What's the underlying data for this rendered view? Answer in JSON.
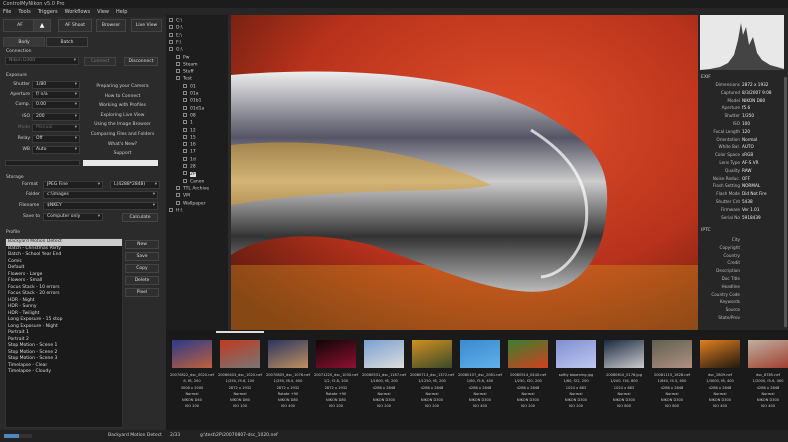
{
  "window": {
    "title": "ControlMyNikon v5.0 Pro"
  },
  "menu": [
    "File",
    "Tools",
    "Triggers",
    "Workflows",
    "View",
    "Help"
  ],
  "toolbar": {
    "af": "AF",
    "af_shoot": "AF Shoot",
    "browser": "Browser",
    "live_view": "Live View"
  },
  "tabs": {
    "body": "Body",
    "batch": "Batch"
  },
  "connection": {
    "label": "Connection",
    "camera": "Nikon D300",
    "connect": "Connect",
    "disconnect": "Disconnect"
  },
  "exposure": {
    "label": "Exposure",
    "rows": [
      {
        "label": "Shutter",
        "value": "1/80"
      },
      {
        "label": "Aperture",
        "value": "f/ n/a"
      },
      {
        "label": "Comp.",
        "value": "0.00"
      },
      {
        "label": "ISO",
        "value": "200"
      },
      {
        "label": "Mode",
        "value": "Manual"
      },
      {
        "label": "Relay",
        "value": "Off"
      },
      {
        "label": "WB",
        "value": "Auto"
      }
    ]
  },
  "help_links": [
    "Preparing your Camera",
    "How to Connect",
    "Working with Profiles",
    "Exploring Live View",
    "Using the Image Browser",
    "Comparing Files and Folders",
    "What's New?",
    "Support"
  ],
  "storage": {
    "label": "Storage",
    "format_label": "Format",
    "format": "JPEG Fine",
    "size": "L(4288*2848)",
    "folder_label": "Folder",
    "folder": "c:\\images",
    "filename_label": "Filename",
    "filename": "$NKEY",
    "saveto_label": "Save to",
    "saveto": "Computer only",
    "calculate": "Calculate"
  },
  "profile": {
    "label": "Profile",
    "items": [
      "Backyard Motion Detect",
      "Batch - Christmas Party",
      "Batch - School Year End",
      "Comic",
      "Default",
      "Flowers - Large",
      "Flowers - Small",
      "Focus Stack - 10 errors",
      "Focus Stack - 20 errors",
      "HDR - Night",
      "HDR - Sunny",
      "HDR - Twilight",
      "Long Exposure - 15 stop",
      "Long Exposure - Night",
      "Portrait 1",
      "Portrait 2",
      "Stop Motion - Scene 1",
      "Stop Motion - Scene 2",
      "Stop Motion - Scene 3",
      "Timelapse - Clear",
      "Timelapse - Cloudy"
    ],
    "buttons": [
      "New",
      "Save",
      "Copy",
      "Delete",
      "Pixel"
    ]
  },
  "tree": [
    {
      "d": 0,
      "t": "C:\\"
    },
    {
      "d": 0,
      "t": "D:\\"
    },
    {
      "d": 0,
      "t": "E:\\"
    },
    {
      "d": 0,
      "t": "F:\\"
    },
    {
      "d": 0,
      "t": "G:\\"
    },
    {
      "d": 1,
      "t": "Pw"
    },
    {
      "d": 1,
      "t": "Steam"
    },
    {
      "d": 1,
      "t": "Stuff"
    },
    {
      "d": 1,
      "t": "Test"
    },
    {
      "d": 2,
      "t": "01"
    },
    {
      "d": 2,
      "t": "01a"
    },
    {
      "d": 2,
      "t": "01b1"
    },
    {
      "d": 2,
      "t": "01d1a"
    },
    {
      "d": 2,
      "t": "08"
    },
    {
      "d": 2,
      "t": "1"
    },
    {
      "d": 2,
      "t": "12"
    },
    {
      "d": 2,
      "t": "15"
    },
    {
      "d": 2,
      "t": "16"
    },
    {
      "d": 2,
      "t": "17"
    },
    {
      "d": 2,
      "t": "1d"
    },
    {
      "d": 2,
      "t": "28"
    },
    {
      "d": 2,
      "t": "2P"
    },
    {
      "d": 2,
      "t": "Canon"
    },
    {
      "d": 1,
      "t": "TTL Archive"
    },
    {
      "d": 1,
      "t": "VM"
    },
    {
      "d": 1,
      "t": "Wallpaper"
    },
    {
      "d": 0,
      "t": "H:\\"
    }
  ],
  "exif": {
    "label": "EXIF",
    "rows": [
      {
        "k": "Dimensions",
        "v": "2872 x 1932"
      },
      {
        "k": "Captured",
        "v": "8/3/2007 9:08"
      },
      {
        "k": "Model",
        "v": "NIKON D80"
      },
      {
        "k": "Aperture",
        "v": "f5.6"
      },
      {
        "k": "Shutter",
        "v": "1/250"
      },
      {
        "k": "ISO",
        "v": "100"
      },
      {
        "k": "Focal Length",
        "v": "120"
      },
      {
        "k": "Orientation",
        "v": "Normal"
      },
      {
        "k": "White Bal.",
        "v": "AUTO"
      },
      {
        "k": "Color Space",
        "v": "sRGB"
      },
      {
        "k": "Lens Type",
        "v": "AF-S VR"
      },
      {
        "k": "Quality",
        "v": "RAW"
      },
      {
        "k": "Noise Reduc.",
        "v": "OFF"
      },
      {
        "k": "Flash Setting",
        "v": "NORMAL"
      },
      {
        "k": "Flash Mode",
        "v": "Did Not Fire"
      },
      {
        "k": "Shutter Cnt",
        "v": "5438"
      },
      {
        "k": "Firmware",
        "v": "Ver 1.01"
      },
      {
        "k": "Serial No",
        "v": "5918439"
      }
    ]
  },
  "iptc": {
    "label": "IPTC",
    "rows": [
      "City",
      "Copyright",
      "Country",
      "Credit",
      "Description",
      "Doc Title",
      "Headline",
      "Country Code",
      "Keywords",
      "Source",
      "State/Prov"
    ]
  },
  "thumbs": [
    {
      "name": "20070822_dsc_0020.nef",
      "exp": "8, f8, 200",
      "dim": "3008 x 2000",
      "orient": "Normal",
      "model": "NIKON D40",
      "iso": "ISO 200",
      "c1": "#2a3a8a",
      "c2": "#c0603a"
    },
    {
      "name": "20060403_dsc_1020.nef",
      "exp": "1/250, f5.6, 100",
      "dim": "2872 x 1932",
      "orient": "Normal",
      "model": "NIKON D80",
      "iso": "ISO 100",
      "c1": "#c03a20",
      "c2": "#777"
    },
    {
      "name": "20070805_dsc_1076.nef",
      "exp": "1/250, f8.0, 400",
      "dim": "2872 x 1932",
      "orient": "Rotate +90",
      "model": "NIKON D80",
      "iso": "ISO 400",
      "c1": "#2a3560",
      "c2": "#c09060"
    },
    {
      "name": "20071220_dsc_1030.nef",
      "exp": "1/2, f2.8, 200",
      "dim": "2872 x 1932",
      "orient": "Rotate +90",
      "model": "NIKON D80",
      "iso": "ISO 200",
      "c1": "#100508",
      "c2": "#901030"
    },
    {
      "name": "20080531_dsc_1167.nef",
      "exp": "1/1600, f8, 200",
      "dim": "4288 x 2848",
      "orient": "Normal",
      "model": "NIKON D300",
      "iso": "ISO 200",
      "c1": "#7aa0d0",
      "c2": "#ddd"
    },
    {
      "name": "20080713_dsc_1372.nef",
      "exp": "1/1250, f8, 200",
      "dim": "4288 x 2848",
      "orient": "Normal",
      "model": "NIKON D300",
      "iso": "ISO 200",
      "c1": "#d09020",
      "c2": "#3a4a2a"
    },
    {
      "name": "20080107_dsc_2081.nef",
      "exp": "1/60, f5.6, 400",
      "dim": "4288 x 2848",
      "orient": "Normal",
      "model": "NIKON D300",
      "iso": "ISO 400",
      "c1": "#3a8ad0",
      "c2": "#60b0e8"
    },
    {
      "name": "20080514_0440.nef",
      "exp": "1/250, f20, 200",
      "dim": "4288 x 2848",
      "orient": "Normal",
      "model": "NIKON D300",
      "iso": "ISO 200",
      "c1": "#3a8030",
      "c2": "#d04020"
    },
    {
      "name": "softly blooming.jpg",
      "exp": "1/60, f22, 200",
      "dim": "1024 x 683",
      "orient": "Normal",
      "model": "NIKON D300",
      "iso": "ISO 200",
      "c1": "#8090d0",
      "c2": "#c0c8f0"
    },
    {
      "name": "20080610_0176.jpg",
      "exp": "1/200, f16, 800",
      "dim": "1024 x 683",
      "orient": "Normal",
      "model": "NIKON D300",
      "iso": "ISO 800",
      "c1": "#1a2a40",
      "c2": "#ccc"
    },
    {
      "name": "20081115_1628.nef",
      "exp": "1/640, f4.5, 800",
      "dim": "4288 x 2848",
      "orient": "Normal",
      "model": "NIKON D300",
      "iso": "ISO 800",
      "c1": "#606050",
      "c2": "#b09080"
    },
    {
      "name": "dsc_2809.nef",
      "exp": "1/4000, f8, 400",
      "dim": "4288 x 2848",
      "orient": "Normal",
      "model": "NIKON D300",
      "iso": "ISO 400",
      "c1": "#e08020",
      "c2": "#201810"
    },
    {
      "name": "dsc_8785.nef",
      "exp": "1/2000, f5.6, 400",
      "dim": "4288 x 2848",
      "orient": "Normal",
      "model": "NIKON D300",
      "iso": "ISO 400",
      "c1": "#c0b0a0",
      "c2": "#a04030"
    }
  ],
  "status": {
    "profile": "Backyard Motion Detect",
    "count": "2/33",
    "path": "g:\\test\\2P\\20070807-dsc_1020.nef",
    "progress": 0.55
  },
  "colors": {
    "accent": "#ffffff",
    "panel": "#2b2b2b"
  }
}
